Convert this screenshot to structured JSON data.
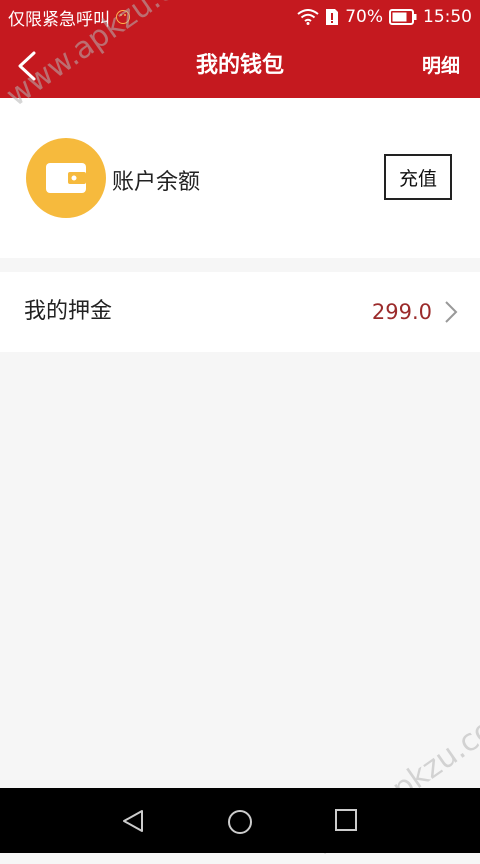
{
  "statusbar": {
    "carrier": "仅限紧急呼叫",
    "battery": "70%",
    "time": "15:50"
  },
  "navbar": {
    "title": "我的钱包",
    "detail_label": "明细"
  },
  "balance": {
    "label": "账户余额",
    "recharge_label": "充值"
  },
  "deposit": {
    "label": "我的押金",
    "amount": "299.0"
  },
  "watermark": {
    "text": "www.apkzu.com"
  },
  "colors": {
    "brand": "#c5191f",
    "wallet": "#f6ba3d",
    "amount": "#9b2b2b"
  }
}
